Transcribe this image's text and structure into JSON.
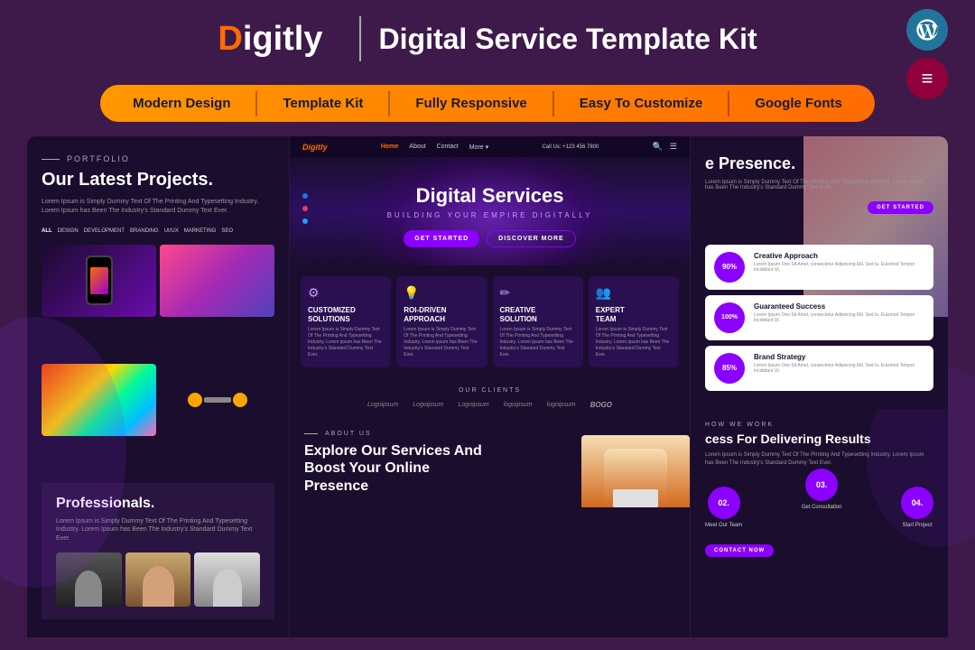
{
  "header": {
    "logo": "Digitly",
    "logo_d": "D",
    "logo_rest": "igitly",
    "title": "Digital Service Template Kit",
    "wp_icon": "W",
    "elementor_icon": "E"
  },
  "nav": {
    "items": [
      "Modern Design",
      "Template Kit",
      "Fully Responsive",
      "Easy To Customize",
      "Google Fonts"
    ]
  },
  "left_panel": {
    "portfolio_label": "PORTFOLIO",
    "title": "Our Latest Projects.",
    "subtitle": "Lorem Ipsum is Simply Dummy Text Of The Printing And Typesetting Industry. Lorem Ipsum has Been The Industry's Standard Dummy Text Ever.",
    "filters": [
      "ALL",
      "DESIGN",
      "DEVELOPMENT",
      "BRANDING",
      "UI/UX",
      "MARKETING",
      "SEO"
    ],
    "professionals_title": "Professionals.",
    "professionals_text": "Lorem Ipsum is Simply Dummy Text Of The Printing And Typesetting Industry. Lorem Ipsum has Been The Industry's Standard Dummy Text Ever."
  },
  "center_panel": {
    "mini_logo": "Digitly",
    "mini_links": [
      "Home",
      "About",
      "Contact",
      "More ▾"
    ],
    "mini_cta": "Call Us: +123 456 7800",
    "hero_title": "Digital Services",
    "hero_subtitle": "BUILDING YOUR EMPIRE DIGITALLY",
    "btn_start": "GET STARTED",
    "btn_discover": "DISCOVER MORE",
    "services": [
      {
        "icon": "⚙",
        "name": "CUSTOMIZED SOLUTIONS",
        "desc": "Lorem Ipsum is Simply Dummy Text Of The Printing And Typesetting Industry. Lorem Ipsum has Been The Industry's Standard Dummy Text Ever."
      },
      {
        "icon": "💡",
        "name": "ROI-DRIVEN APPROACH",
        "desc": "Lorem Ipsum is Simply Dummy Text Of The Printing And Typesetting Industry. Lorem Ipsum has Been The Industry's Standard Dummy Text Ever."
      },
      {
        "icon": "✏",
        "name": "CREATIVE SOLUTION",
        "desc": "Lorem Ipsum is Simply Dummy Text Of The Printing And Typesetting Industry. Lorem Ipsum has Been The Industry's Standard Dummy Text Ever."
      },
      {
        "icon": "👥",
        "name": "EXPERT TEAM",
        "desc": "Lorem Ipsum is Simply Dummy Text Of The Printing And Typesetting Industry. Lorem Ipsum has Been The Industry's Standard Dummy Text Ever."
      }
    ],
    "clients_label": "OUR CLIENTS",
    "clients": [
      "Logoipsum",
      "Logoipsum",
      "Logoipsum",
      "logoipsum",
      "logoipsum",
      "BOGO"
    ],
    "about_label": "ABOUT US",
    "about_title": "Explore Our Services And Boost Your Online Presence"
  },
  "right_panel": {
    "presence_title": "e Presence.",
    "presence_text": "Lorem Ipsum is Simply Dummy Text Of The Printing And Typesetting Industry. Lorem Ipsum has Been The Industry's Standard Dummy Text Ever.",
    "get_started": "GET STARTED",
    "stats": [
      {
        "percent": "90%",
        "name": "Creative Approach",
        "desc": "Lorem Ipsum One Sit Amet, consectetur Adipiscing Elit. Sed Iu. Euismod Tempor Incididunt Ut."
      },
      {
        "percent": "100%",
        "name": "Guaranteed Success",
        "desc": "Lorem Ipsum One Sit Amet, consectetur Adipiscing Elit. Sed Iu. Euismod Tempor Incididunt Ut."
      },
      {
        "percent": "85%",
        "name": "Brand Strategy",
        "desc": "Lorem Ipsum One Sit Amet, consectetur Adipiscing Elit. Sed Iu. Euismod Tempor Incididunt Ut."
      }
    ],
    "how_we_work": "HOW WE WORK",
    "process_title": "cess For Delivering Results",
    "process_text": "Lorem Ipsum is Simply Dummy Text Of The Printing And Typesetting Industry. Lorem Ipsum has Been The Industry's Standard Dummy Text Ever.",
    "steps": [
      {
        "num": "02.",
        "label": "Meet Our Team"
      },
      {
        "num": "03.",
        "label": "Get Consultation"
      },
      {
        "num": "04.",
        "label": "Start Project"
      }
    ],
    "contact_btn": "CONTACT NOW"
  },
  "colors": {
    "bg_primary": "#3d1a4a",
    "bg_dark": "#1a0d2e",
    "accent_purple": "#8b00ff",
    "accent_orange": "#ff6b00",
    "text_light": "#ffffff",
    "text_muted": "#999999"
  }
}
